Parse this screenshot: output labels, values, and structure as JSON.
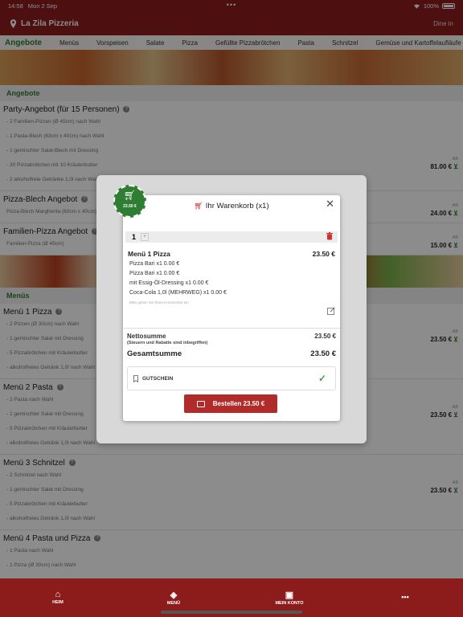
{
  "status_bar": {
    "time": "14:58",
    "date": "Mon 2 Sep",
    "battery": "100%"
  },
  "app_bar": {
    "title": "La Zila Pizzeria",
    "mode": "Dine in"
  },
  "category_nav": [
    "Angebote",
    "Menüs",
    "Vorspeisen",
    "Salate",
    "Pizza",
    "Gefüllte Pizzabrötchen",
    "Pasta",
    "Schnitzel",
    "Gemüse und Kartoffelaufläufe"
  ],
  "sections": {
    "angebote": "Angebote",
    "menus": "Menüs"
  },
  "items": [
    {
      "name": "Party-Angebot (für 15 Personen)",
      "lines": [
        "- 2 Familien-Pizzen (Ø 45cm) nach Wahl",
        "- 1 Pasta-Blech (63cm x 40cm) nach Wahl",
        "- 1 gemischter Salat-Blech mit Dressing",
        "- 30 Pizzabrötchen mit 10 Kräuterbutter",
        "- 2 alkoholfreie Getränke 1,0l nach Wahl"
      ],
      "prefix": "AB",
      "price": "81.00 €"
    },
    {
      "name": "Pizza-Blech Angebot",
      "lines": [
        "Pizza-Blech Margherita (60cm x 40cm)"
      ],
      "prefix": "AB",
      "price": "24.00 €"
    },
    {
      "name": "Familien-Pizza Angebot",
      "lines": [
        "Familien-Pizza (Ø 45cm)"
      ],
      "prefix": "AB",
      "price": "15.00 €"
    },
    {
      "name": "Menü 1 Pizza",
      "lines": [
        "- 2 Pizzen (Ø 30cm) nach Wahl",
        "- 1 gemischter Salat mit Dressing",
        "- 5 Pizzabrötchen mit Kräuterbutter",
        "- alkoholfreies Getränk 1,0l nach Wahl"
      ],
      "prefix": "AB",
      "price": "23.50 €"
    },
    {
      "name": "Menü 2 Pasta",
      "lines": [
        "- 2 Pasta nach Wahl",
        "- 1 gemischter Salat mit Dressing",
        "- 5 Pizzabrötchen mit Kräuterbutter",
        "- alkoholfreies Getränk 1,0l nach Wahl"
      ],
      "prefix": "AB",
      "price": "23.50 €"
    },
    {
      "name": "Menü 3 Schnitzel",
      "lines": [
        "- 2 Schnitzel nach Wahl",
        "- 1 gemischter Salat mit Dressing",
        "- 5 Pizzabrötchen mit Kräuterbutter",
        "- alkoholfreies Getränk 1,0l nach Wahl"
      ],
      "prefix": "AB",
      "price": "23.50 €"
    },
    {
      "name": "Menü 4 Pasta und Pizza",
      "lines": [
        "- 1 Pasta nach Wahl",
        "- 1 Pizza (Ø 30cm) nach Wahl"
      ],
      "prefix": "",
      "price": ""
    }
  ],
  "cart_badge": {
    "amount": "23.50 €"
  },
  "cart_modal": {
    "title": "Ihr Warenkorb (x1)",
    "quantity": "1",
    "product_name": "Menü 1 Pizza",
    "product_price": "23.50 €",
    "options": [
      "Pizza Bari x1 0.00 €",
      "Pizza Bari x1 0.00 €",
      "mit Essig-Öl-Dressing x1 0.00 €",
      "Coca-Cola 1,0l (MEHRWEG) x1 0.00 €"
    ],
    "comment_hint": "Bitte geben Sie Ihren Kommentar ein",
    "net_label": "Nettosumme",
    "net_value": "23.50 €",
    "tax_note": "(Steuern und Rabatte sind inbegriffen)",
    "total_label": "Gesamtsumme",
    "total_value": "23.50 €",
    "voucher_label": "GUTSCHEIN",
    "order_button": "Bestellen 23.50 €"
  },
  "tab_bar": {
    "home": "HEIM",
    "menu": "MENÜ",
    "account": "MEIN KONTO",
    "more": "•••"
  }
}
